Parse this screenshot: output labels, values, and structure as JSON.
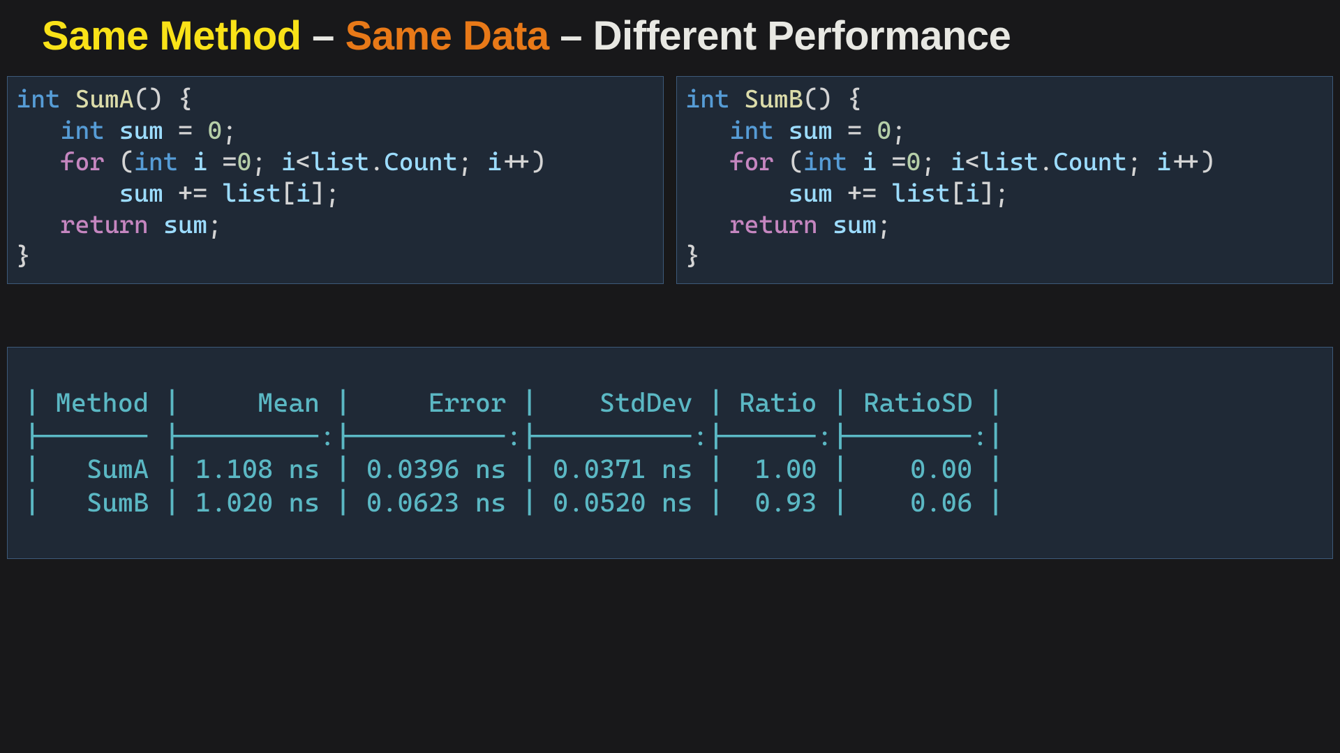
{
  "title": {
    "part1": "Same Method",
    "sep1": " – ",
    "part2": "Same Data",
    "sep2": " – ",
    "part3": "Different Performance"
  },
  "code_left": {
    "fn_name": "SumA",
    "lines": [
      {
        "indent": "",
        "tokens": [
          [
            "kw",
            "int"
          ],
          [
            "op",
            " "
          ],
          [
            "fn",
            "SumA"
          ],
          [
            "paren",
            "() {"
          ]
        ]
      },
      {
        "indent": "   ",
        "tokens": [
          [
            "kw",
            "int"
          ],
          [
            "op",
            " "
          ],
          [
            "var",
            "sum"
          ],
          [
            "op",
            " = "
          ],
          [
            "num",
            "0"
          ],
          [
            "op",
            ";"
          ]
        ]
      },
      {
        "indent": "   ",
        "tokens": [
          [
            "ctrl",
            "for"
          ],
          [
            "op",
            " ("
          ],
          [
            "kw",
            "int"
          ],
          [
            "op",
            " "
          ],
          [
            "var",
            "i"
          ],
          [
            "op",
            " ="
          ],
          [
            "num",
            "0"
          ],
          [
            "op",
            "; "
          ],
          [
            "var",
            "i"
          ],
          [
            "op",
            "<"
          ],
          [
            "var",
            "list"
          ],
          [
            "op",
            "."
          ],
          [
            "var",
            "Count"
          ],
          [
            "op",
            "; "
          ],
          [
            "var",
            "i"
          ],
          [
            "op",
            "++)"
          ]
        ]
      },
      {
        "indent": "       ",
        "tokens": [
          [
            "var",
            "sum"
          ],
          [
            "op",
            " += "
          ],
          [
            "var",
            "list"
          ],
          [
            "op",
            "["
          ],
          [
            "var",
            "i"
          ],
          [
            "op",
            "];"
          ]
        ]
      },
      {
        "indent": "   ",
        "tokens": [
          [
            "ctrl",
            "return"
          ],
          [
            "op",
            " "
          ],
          [
            "var",
            "sum"
          ],
          [
            "op",
            ";"
          ]
        ]
      },
      {
        "indent": "",
        "tokens": [
          [
            "op",
            "}"
          ]
        ]
      }
    ]
  },
  "code_right": {
    "fn_name": "SumB",
    "lines": [
      {
        "indent": "",
        "tokens": [
          [
            "kw",
            "int"
          ],
          [
            "op",
            " "
          ],
          [
            "fn",
            "SumB"
          ],
          [
            "paren",
            "() {"
          ]
        ]
      },
      {
        "indent": "   ",
        "tokens": [
          [
            "kw",
            "int"
          ],
          [
            "op",
            " "
          ],
          [
            "var",
            "sum"
          ],
          [
            "op",
            " = "
          ],
          [
            "num",
            "0"
          ],
          [
            "op",
            ";"
          ]
        ]
      },
      {
        "indent": "   ",
        "tokens": [
          [
            "ctrl",
            "for"
          ],
          [
            "op",
            " ("
          ],
          [
            "kw",
            "int"
          ],
          [
            "op",
            " "
          ],
          [
            "var",
            "i"
          ],
          [
            "op",
            " ="
          ],
          [
            "num",
            "0"
          ],
          [
            "op",
            "; "
          ],
          [
            "var",
            "i"
          ],
          [
            "op",
            "<"
          ],
          [
            "var",
            "list"
          ],
          [
            "op",
            "."
          ],
          [
            "var",
            "Count"
          ],
          [
            "op",
            "; "
          ],
          [
            "var",
            "i"
          ],
          [
            "op",
            "++)"
          ]
        ]
      },
      {
        "indent": "       ",
        "tokens": [
          [
            "var",
            "sum"
          ],
          [
            "op",
            " += "
          ],
          [
            "var",
            "list"
          ],
          [
            "op",
            "["
          ],
          [
            "var",
            "i"
          ],
          [
            "op",
            "];"
          ]
        ]
      },
      {
        "indent": "   ",
        "tokens": [
          [
            "ctrl",
            "return"
          ],
          [
            "op",
            " "
          ],
          [
            "var",
            "sum"
          ],
          [
            "op",
            ";"
          ]
        ]
      },
      {
        "indent": "",
        "tokens": [
          [
            "op",
            "}"
          ]
        ]
      }
    ]
  },
  "chart_data": {
    "type": "table",
    "columns": [
      "Method",
      "Mean",
      "Error",
      "StdDev",
      "Ratio",
      "RatioSD"
    ],
    "rows": [
      {
        "Method": "SumA",
        "Mean": "1.108 ns",
        "Error": "0.0396 ns",
        "StdDev": "0.0371 ns",
        "Ratio": "1.00",
        "RatioSD": "0.00"
      },
      {
        "Method": "SumB",
        "Mean": "1.020 ns",
        "Error": "0.0623 ns",
        "StdDev": "0.0520 ns",
        "Ratio": "0.93",
        "RatioSD": "0.06"
      }
    ],
    "raw_lines": [
      "| Method |     Mean |     Error |    StdDev | Ratio | RatioSD |",
      "|------- |---------:|----------:|----------:|------:|--------:|",
      "|   SumA | 1.108 ns | 0.0396 ns | 0.0371 ns |  1.00 |    0.00 |",
      "|   SumB | 1.020 ns | 0.0623 ns | 0.0520 ns |  0.93 |    0.06 |"
    ]
  }
}
